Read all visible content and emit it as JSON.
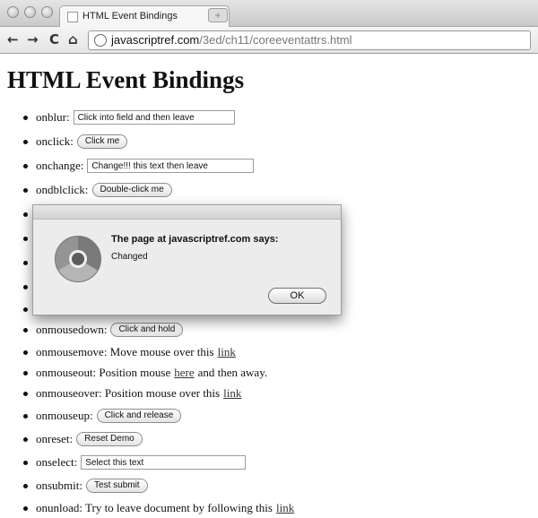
{
  "browser": {
    "tab_title": "HTML Event Bindings",
    "tab_close": "×",
    "new_tab": "+",
    "back": "←",
    "forward": "→",
    "reload": "C",
    "home": "⌂",
    "url_host": "javascriptref.com",
    "url_path": "/3ed/ch11/coreeventattrs.html"
  },
  "page": {
    "title": "HTML Event Bindings",
    "rows": [
      {
        "label": "onblur:",
        "input_value": "Click into field and then leave"
      },
      {
        "label": "onclick:",
        "button": "Click me"
      },
      {
        "label": "onchange:",
        "input_value": "Change!!! this text then leave"
      },
      {
        "label": "ondblclick:",
        "button": "Double-click me"
      },
      {
        "label": "onmousedown:",
        "button": "Click and hold"
      },
      {
        "label": "onmousemove: Move mouse over this",
        "link": "link"
      },
      {
        "label": "onmouseout: Position mouse",
        "link": "here",
        "after": "and then away."
      },
      {
        "label": "onmouseover: Position mouse over this",
        "link": "link"
      },
      {
        "label": "onmouseup:",
        "button": "Click and release"
      },
      {
        "label": "onreset:",
        "button": "Reset Demo"
      },
      {
        "label": "onselect:",
        "input_value": "Select this text"
      },
      {
        "label": "onsubmit:",
        "button": "Test submit"
      },
      {
        "label": "onunload: Try to leave document by following this",
        "link": "link"
      }
    ]
  },
  "dialog": {
    "title": "The page at javascriptref.com says:",
    "message": "Changed",
    "ok": "OK"
  }
}
